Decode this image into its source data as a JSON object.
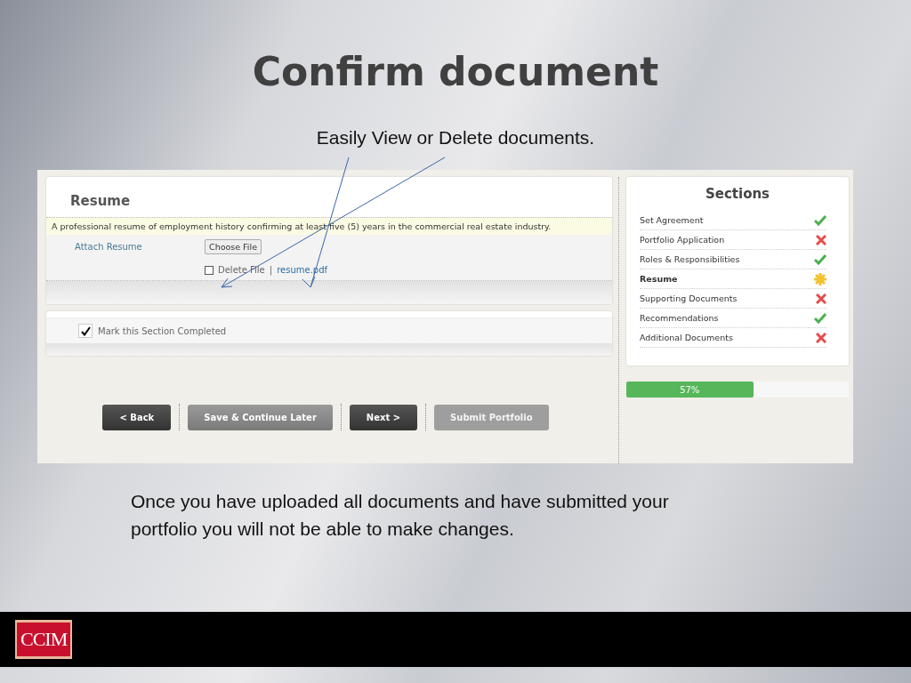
{
  "slide": {
    "title": "Confirm document",
    "subtitle": "Easily View or Delete documents.",
    "note": "Once you have uploaded all documents and have submitted your portfolio you will not be able to make changes."
  },
  "section_card": {
    "title": "Resume",
    "description": "A professional resume of employment history confirming at least five (5) years in the commercial real estate industry.",
    "attach_label": "Attach Resume",
    "choose_button": "Choose File",
    "delete_checkbox": {
      "label": "Delete File",
      "checked": false
    },
    "separator": "|",
    "file_link": "resume.pdf"
  },
  "completion": {
    "label": "Mark this Section Completed",
    "checked": true
  },
  "buttons": [
    {
      "label": "< Back",
      "kind": "dark",
      "disabled": false
    },
    {
      "label": "Save & Continue Later",
      "kind": "grey",
      "disabled": false
    },
    {
      "label": "Next >",
      "kind": "dark",
      "disabled": false
    },
    {
      "label": "Submit Portfolio",
      "kind": "grey",
      "disabled": true
    }
  ],
  "sections": {
    "title": "Sections",
    "items": [
      {
        "label": "Set Agreement",
        "kind": "done",
        "selected": false
      },
      {
        "label": "Portfolio Application",
        "kind": "missing",
        "selected": false
      },
      {
        "label": "Roles & Responsibilities",
        "kind": "done",
        "selected": false
      },
      {
        "label": "Resume",
        "kind": "current",
        "selected": true
      },
      {
        "label": "Supporting Documents",
        "kind": "missing",
        "selected": false
      },
      {
        "label": "Recommendations",
        "kind": "done",
        "selected": false
      },
      {
        "label": "Additional Documents",
        "kind": "missing",
        "selected": false
      }
    ]
  },
  "progress": {
    "level": 0.57,
    "reading": "57%"
  },
  "footer": {
    "logo": "CCIM"
  }
}
